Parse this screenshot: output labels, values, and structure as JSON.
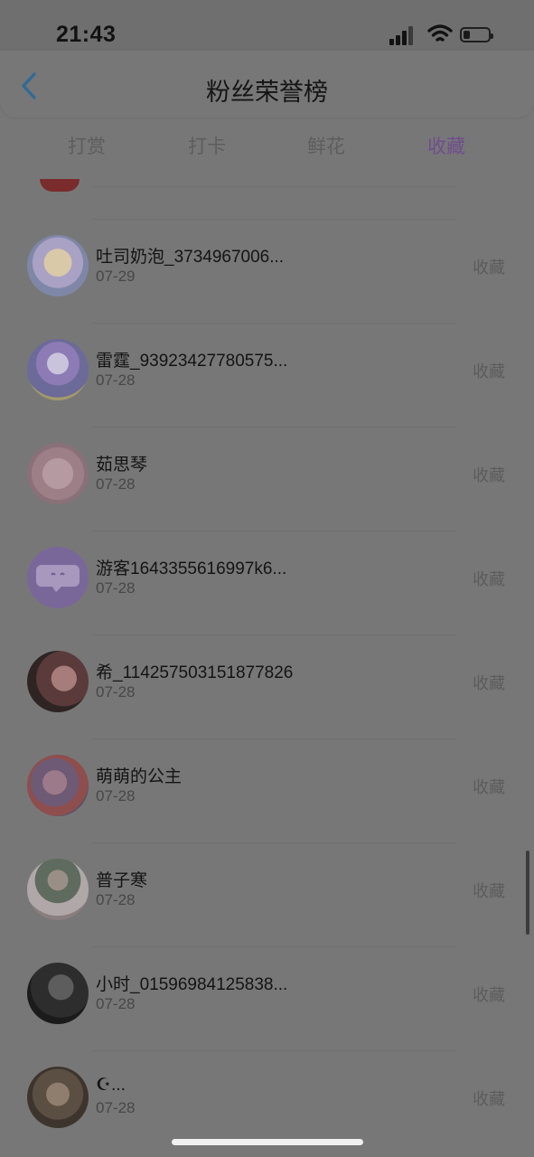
{
  "status_bar": {
    "time": "21:43"
  },
  "header": {
    "title": "粉丝荣誉榜",
    "back_icon": "chevron-left-icon"
  },
  "tabs": [
    {
      "label": "打赏",
      "active": false
    },
    {
      "label": "打卡",
      "active": false
    },
    {
      "label": "鲜花",
      "active": false
    },
    {
      "label": "收藏",
      "active": true
    }
  ],
  "colors": {
    "accent": "#6f4d8e",
    "back_arrow": "#2f6a95"
  },
  "items": [
    {
      "name": "吐司奶泡_3734967006...",
      "date": "07-29",
      "action": "收藏"
    },
    {
      "name": "雷霆_93923427780575...",
      "date": "07-28",
      "action": "收藏"
    },
    {
      "name": "茹思琴",
      "date": "07-28",
      "action": "收藏"
    },
    {
      "name": "游客1643355616997k6...",
      "date": "07-28",
      "action": "收藏"
    },
    {
      "name": "希_114257503151877826",
      "date": "07-28",
      "action": "收藏"
    },
    {
      "name": "萌萌的公主",
      "date": "07-28",
      "action": "收藏"
    },
    {
      "name": "普子寒",
      "date": "07-28",
      "action": "收藏"
    },
    {
      "name": "小时_01596984125838...",
      "date": "07-28",
      "action": "收藏"
    },
    {
      "name": "☪...",
      "date": "07-28",
      "action": "收藏"
    }
  ]
}
